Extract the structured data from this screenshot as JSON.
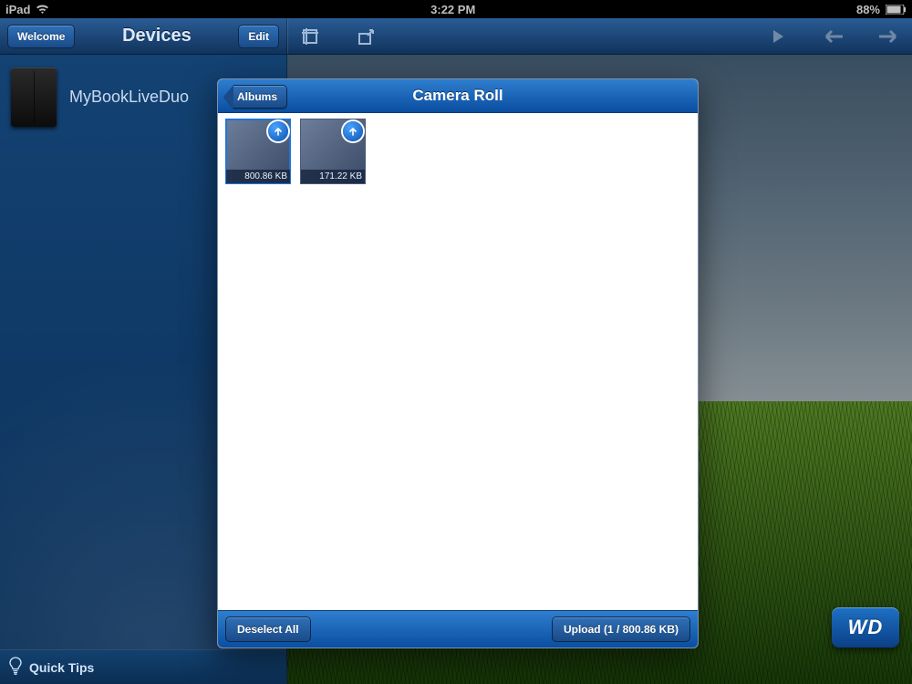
{
  "status": {
    "device": "iPad",
    "time": "3:22 PM",
    "battery": "88%"
  },
  "nav": {
    "back_label": "Welcome",
    "title": "Devices",
    "edit_label": "Edit"
  },
  "sidebar": {
    "devices": [
      {
        "label": "MyBookLiveDuo"
      }
    ],
    "quick_tips_label": "Quick Tips"
  },
  "brand": {
    "wd_label": "WD"
  },
  "modal": {
    "back_label": "Albums",
    "title": "Camera Roll",
    "photos": [
      {
        "size_label": "800.86 KB",
        "selected": true
      },
      {
        "size_label": "171.22 KB",
        "selected": false
      }
    ],
    "deselect_label": "Deselect All",
    "upload_label": "Upload  (1 / 800.86 KB)"
  }
}
